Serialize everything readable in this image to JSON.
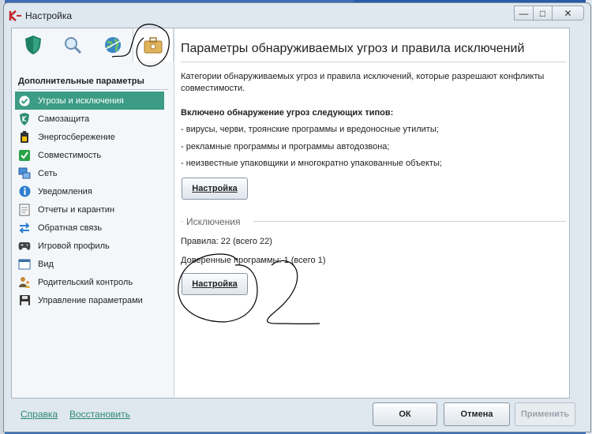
{
  "window": {
    "title": "Настройка",
    "caption": {
      "minimize": "—",
      "maximize": "□",
      "close": "✕"
    }
  },
  "icon_tabs": [
    {
      "name": "protection-tab",
      "icon": "shield-icon"
    },
    {
      "name": "scan-tab",
      "icon": "magnifier-icon"
    },
    {
      "name": "update-tab",
      "icon": "globe-icon"
    },
    {
      "name": "settings-tab",
      "icon": "toolbox-icon",
      "active": true
    }
  ],
  "sidebar": {
    "title": "Дополнительные параметры",
    "items": [
      {
        "label": "Угрозы и исключения",
        "icon": "check-shield-icon",
        "active": true
      },
      {
        "label": "Самозащита",
        "icon": "k-shield-icon"
      },
      {
        "label": "Энергосбережение",
        "icon": "battery-icon"
      },
      {
        "label": "Совместимость",
        "icon": "checkbox-icon"
      },
      {
        "label": "Сеть",
        "icon": "network-icon"
      },
      {
        "label": "Уведомления",
        "icon": "info-icon"
      },
      {
        "label": "Отчеты и карантин",
        "icon": "report-icon"
      },
      {
        "label": "Обратная связь",
        "icon": "arrows-icon"
      },
      {
        "label": "Игровой профиль",
        "icon": "gamepad-icon"
      },
      {
        "label": "Вид",
        "icon": "window-icon"
      },
      {
        "label": "Родительский контроль",
        "icon": "parent-icon"
      },
      {
        "label": "Управление параметрами",
        "icon": "floppy-icon"
      }
    ]
  },
  "main": {
    "title": "Параметры обнаруживаемых угроз и правила исключений",
    "description": "Категории обнаруживаемых угроз и правила исключений, которые разрешают конфликты совместимости.",
    "detection_title": "Включено обнаружение угроз следующих типов:",
    "threats": [
      "- вирусы, черви, троянские программы и вредоносные утилиты;",
      "- рекламные программы и программы автодозвона;",
      "- неизвестные упаковщики и многократно упакованные объекты;"
    ],
    "settings_button": "Настройка",
    "exclusions_label": "Исключения",
    "rules_text": "Правила: 22 (всего 22)",
    "trusted_text": "Доверенные программы: 1 (всего 1)",
    "exclusions_button": "Настройка"
  },
  "footer": {
    "help_link": "Справка",
    "restore_link": "Восстановить",
    "ok_button": "ОК",
    "cancel_button": "Отмена",
    "apply_button": "Применить"
  },
  "colors": {
    "accent": "#3c9c86",
    "link": "#2a8a6e",
    "desktop": "#3d6fb8"
  }
}
